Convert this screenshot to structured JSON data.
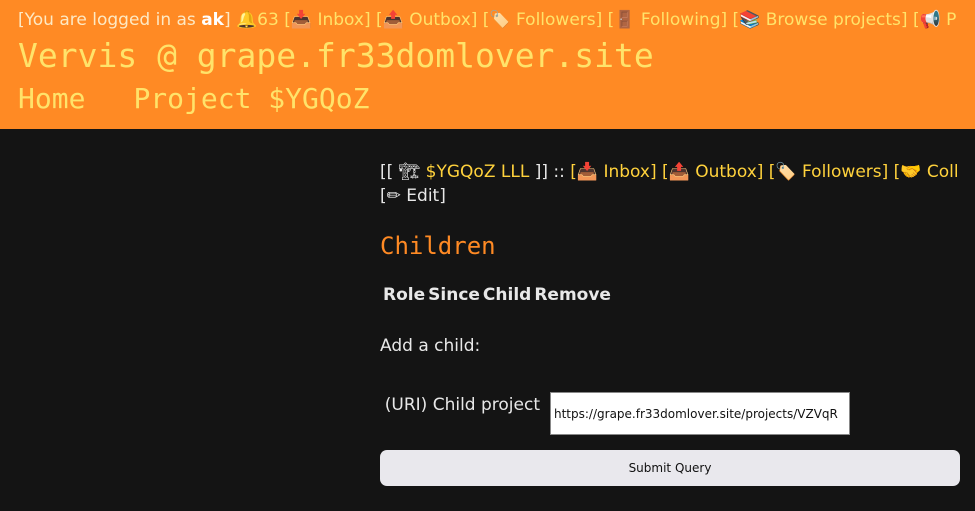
{
  "header": {
    "user_prefix": "[You are logged in as ",
    "username": "ak",
    "user_suffix": "]",
    "notifications": "🔔63",
    "links": [
      "[📥 Inbox]",
      "[📤 Outbox]",
      "[🏷️ Followers]",
      "[🚪 Following]",
      "[📚 Browse projects]",
      "[📢 P"
    ],
    "site_title": "Vervis @ grape.fr33domlover.site",
    "nav": [
      "Home",
      "Project $YGQoZ"
    ]
  },
  "project": {
    "prefix": "[[ 🏗",
    "name": "$YGQoZ LLL",
    "suffix": "]] ::",
    "links": [
      "[📥 Inbox]",
      "[📤 Outbox]",
      "[🏷️ Followers]",
      "[🤝 Coll"
    ],
    "edit": "[✏ Edit]"
  },
  "children": {
    "title": "Children",
    "columns": [
      "Role",
      "Since",
      "Child",
      "Remove"
    ]
  },
  "form": {
    "heading": "Add a child:",
    "field_label": "(URI) Child project",
    "field_value": "https://grape.fr33domlover.site/projects/VZVqR",
    "submit_label": "Submit Query"
  }
}
